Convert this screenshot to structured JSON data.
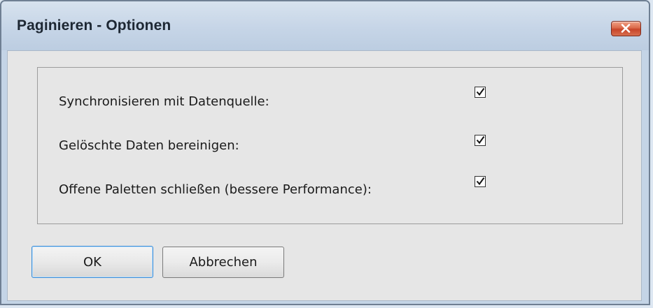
{
  "dialog": {
    "title": "Paginieren - Optionen",
    "close_icon": "close-x-icon"
  },
  "options": [
    {
      "label": "Synchronisieren mit Datenquelle:",
      "checked": true
    },
    {
      "label": "Gelöschte Daten bereinigen:",
      "checked": true
    },
    {
      "label": "Offene Paletten schließen (bessere Performance):",
      "checked": true
    }
  ],
  "buttons": {
    "ok_label": "OK",
    "cancel_label": "Abbrechen"
  },
  "colors": {
    "window_frame": "#c4d4e6",
    "client_background": "#e6e6e6",
    "close_button": "#d0553a",
    "default_button_border": "#3a8cd6"
  }
}
